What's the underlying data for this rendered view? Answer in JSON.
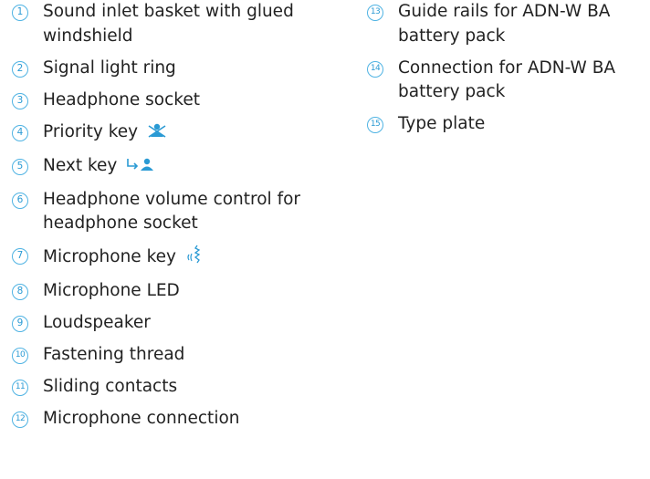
{
  "left_items": [
    {
      "num": "1",
      "text": "Sound inlet basket with glued windshield",
      "icon": null
    },
    {
      "num": "2",
      "text": "Signal light ring",
      "icon": null
    },
    {
      "num": "3",
      "text": "Headphone socket",
      "icon": null
    },
    {
      "num": "4",
      "text": "Priority key",
      "icon": "priority-icon"
    },
    {
      "num": "5",
      "text": "Next key",
      "icon": "next-speaker-icon"
    },
    {
      "num": "6",
      "text": "Headphone volume control for headphone socket",
      "icon": null
    },
    {
      "num": "7",
      "text": "Microphone key",
      "icon": "microphone-speech-icon"
    },
    {
      "num": "8",
      "text": "Microphone LED",
      "icon": null
    },
    {
      "num": "9",
      "text": "Loudspeaker",
      "icon": null
    },
    {
      "num": "10",
      "text": "Fastening thread",
      "icon": null
    },
    {
      "num": "11",
      "text": "Sliding contacts",
      "icon": null
    },
    {
      "num": "12",
      "text": "Microphone connection",
      "icon": null
    }
  ],
  "right_items": [
    {
      "num": "13",
      "text": "Guide rails for ADN-W BA battery pack",
      "icon": null
    },
    {
      "num": "14",
      "text": "Connection for ADN-W BA battery pack",
      "icon": null
    },
    {
      "num": "15",
      "text": "Type plate",
      "icon": null
    }
  ],
  "colors": {
    "number_accent": "#2a9ad4",
    "icon_accent": "#2a9ad4",
    "text": "#222222"
  }
}
